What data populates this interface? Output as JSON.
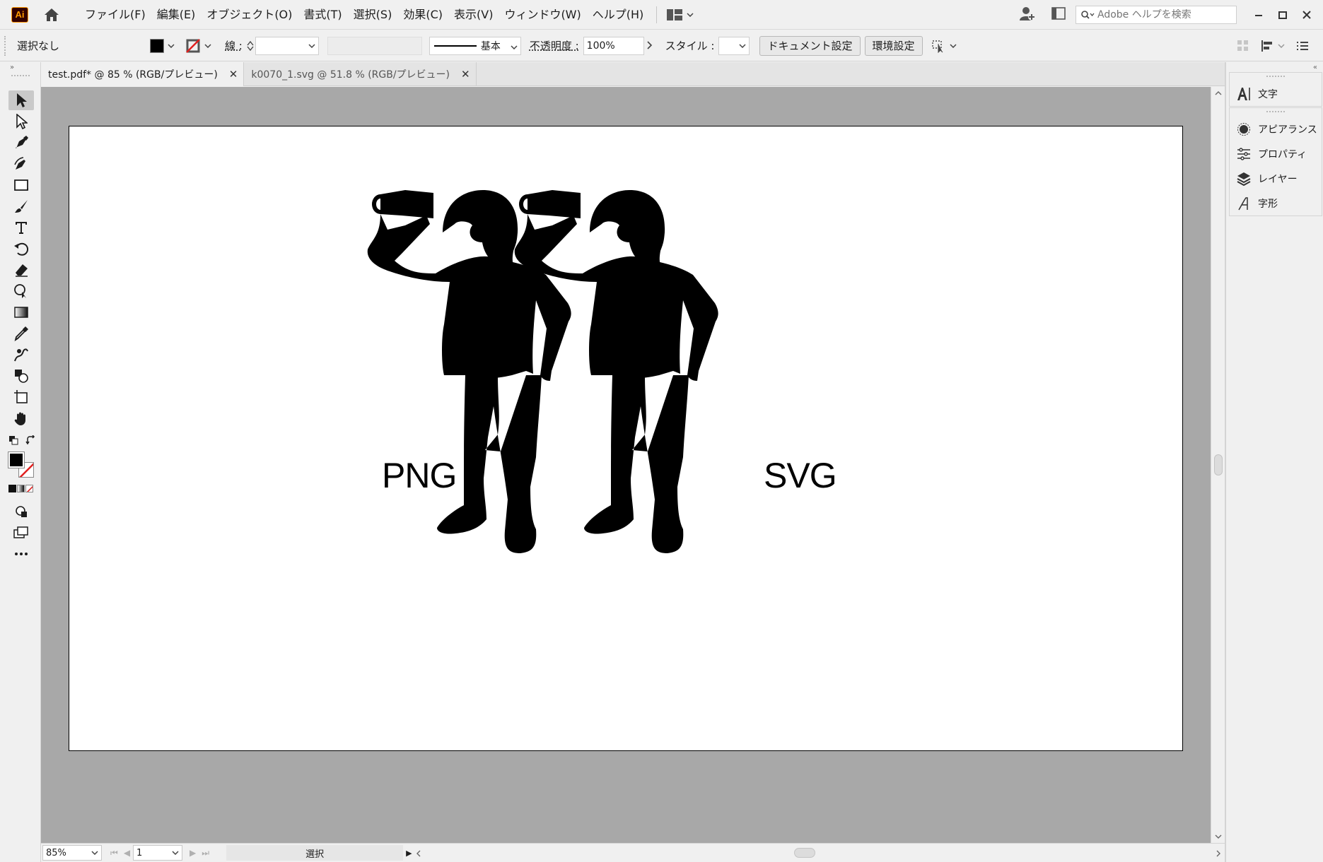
{
  "app": {
    "logo_text": "Ai",
    "brand_color": "#ff9a00"
  },
  "menu": {
    "items": [
      "ファイル(F)",
      "編集(E)",
      "オブジェクト(O)",
      "書式(T)",
      "選択(S)",
      "効果(C)",
      "表示(V)",
      "ウィンドウ(W)",
      "ヘルプ(H)"
    ]
  },
  "search": {
    "placeholder": "Adobe ヘルプを検索"
  },
  "control_bar": {
    "selection": "選択なし",
    "stroke_label": "線 :",
    "stroke_profile": "基本",
    "opacity_label": "不透明度 :",
    "opacity_value": "100%",
    "style_label": "スタイル :",
    "doc_settings_button": "ドキュメント設定",
    "preferences_button": "環境設定"
  },
  "tabs": [
    {
      "label": "test.pdf* @ 85 % (RGB/プレビュー)",
      "active": true
    },
    {
      "label": "k0070_1.svg @ 51.8 % (RGB/プレビュー)",
      "active": false
    }
  ],
  "artboard": {
    "left_label": "PNG",
    "right_label": "SVG"
  },
  "status_bar": {
    "zoom": "85%",
    "page": "1",
    "tool_status": "選択"
  },
  "right_panel": {
    "group1": [
      {
        "label": "文字",
        "icon": "character-icon"
      }
    ],
    "group2": [
      {
        "label": "アピアランス",
        "icon": "appearance-icon"
      },
      {
        "label": "プロパティ",
        "icon": "properties-icon"
      },
      {
        "label": "レイヤー",
        "icon": "layers-icon"
      },
      {
        "label": "字形",
        "icon": "glyphs-icon"
      }
    ]
  },
  "colors": {
    "canvas_bg": "#a8a8a8",
    "chrome_bg": "#f0f0f0",
    "stroke_none_red": "#e0201f"
  }
}
